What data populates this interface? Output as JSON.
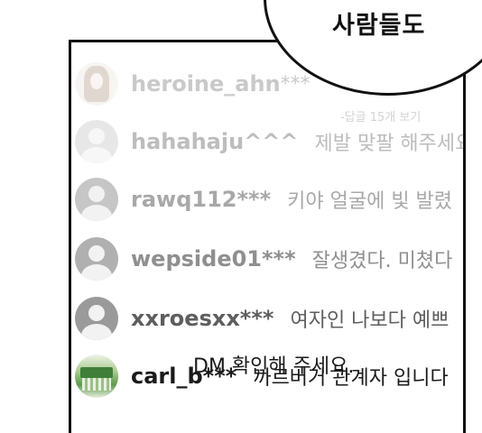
{
  "bubble": {
    "text": "사람들도"
  },
  "comments": [
    {
      "user": "heroine_ahn",
      "text": "***",
      "avatar_icon": "woman-photo-icon"
    },
    {
      "user": "hahahaju^^^",
      "text": "제발 맞팔 해주세요",
      "avatar_icon": "default-user-icon"
    },
    {
      "user": "rawq112***",
      "text": "키야 얼굴에 빛 발렸",
      "avatar_icon": "default-user-icon"
    },
    {
      "user": "wepside01***",
      "text": "잘생겼다. 미쳤다",
      "avatar_icon": "default-user-icon"
    },
    {
      "user": "xxroesxx***",
      "text": "여자인 나보다 예쁘",
      "avatar_icon": "default-user-icon"
    },
    {
      "user": "carl_b***",
      "text": "까르버거 관계자 입니다",
      "text_line2": "DM 확인해 주세요.",
      "avatar_icon": "storefront-photo-icon"
    }
  ],
  "replies_label": "-답글 15개 보기"
}
